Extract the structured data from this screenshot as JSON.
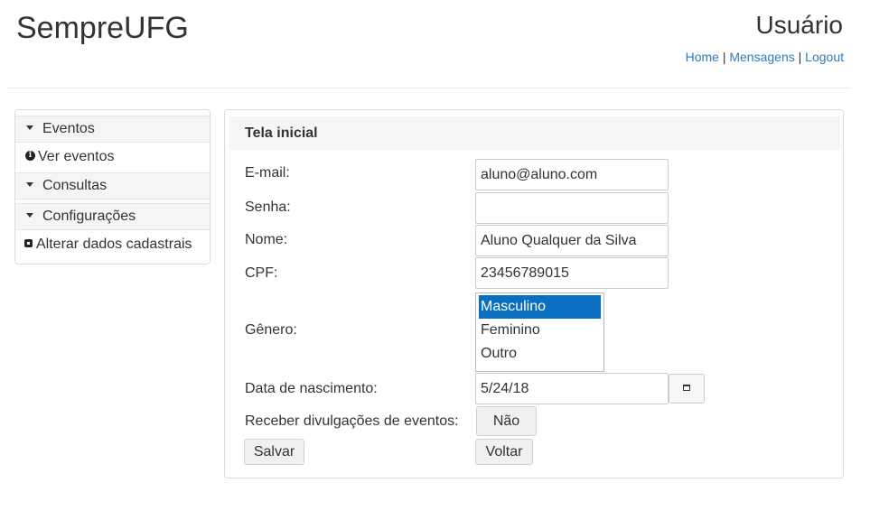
{
  "header": {
    "app_title": "SempreUFG",
    "user_title": "Usuário",
    "links": {
      "home": "Home",
      "mensagens": "Mensagens",
      "logout": "Logout",
      "separator": " | "
    }
  },
  "sidebar": {
    "items": [
      {
        "type": "header",
        "label": "Eventos"
      },
      {
        "type": "item",
        "label": "Ver eventos",
        "icon": "info-icon"
      },
      {
        "type": "header",
        "label": "Consultas"
      },
      {
        "type": "header",
        "label": "Configurações"
      },
      {
        "type": "item",
        "label": "Alterar dados cadastrais",
        "icon": "edit-icon"
      }
    ]
  },
  "panel": {
    "title": "Tela inicial",
    "fields": {
      "email": {
        "label": "E-mail:",
        "value": "aluno@aluno.com"
      },
      "senha": {
        "label": "Senha:",
        "value": ""
      },
      "nome": {
        "label": "Nome:",
        "value": "Aluno Qualquer da Silva"
      },
      "cpf": {
        "label": "CPF:",
        "value": "23456789015"
      },
      "genero": {
        "label": "Gênero:",
        "options": [
          "Masculino",
          "Feminino",
          "Outro"
        ],
        "selected": "Masculino"
      },
      "nascimento": {
        "label": "Data de nascimento:",
        "value": "5/24/18"
      },
      "divulgacoes": {
        "label": "Receber divulgações de eventos:",
        "value": "Não"
      }
    },
    "buttons": {
      "salvar": "Salvar",
      "voltar": "Voltar"
    }
  },
  "colors": {
    "link": "#337ab7",
    "selected_option": "#0a6fc2",
    "panel_heading_bg": "#f5f5f5"
  }
}
